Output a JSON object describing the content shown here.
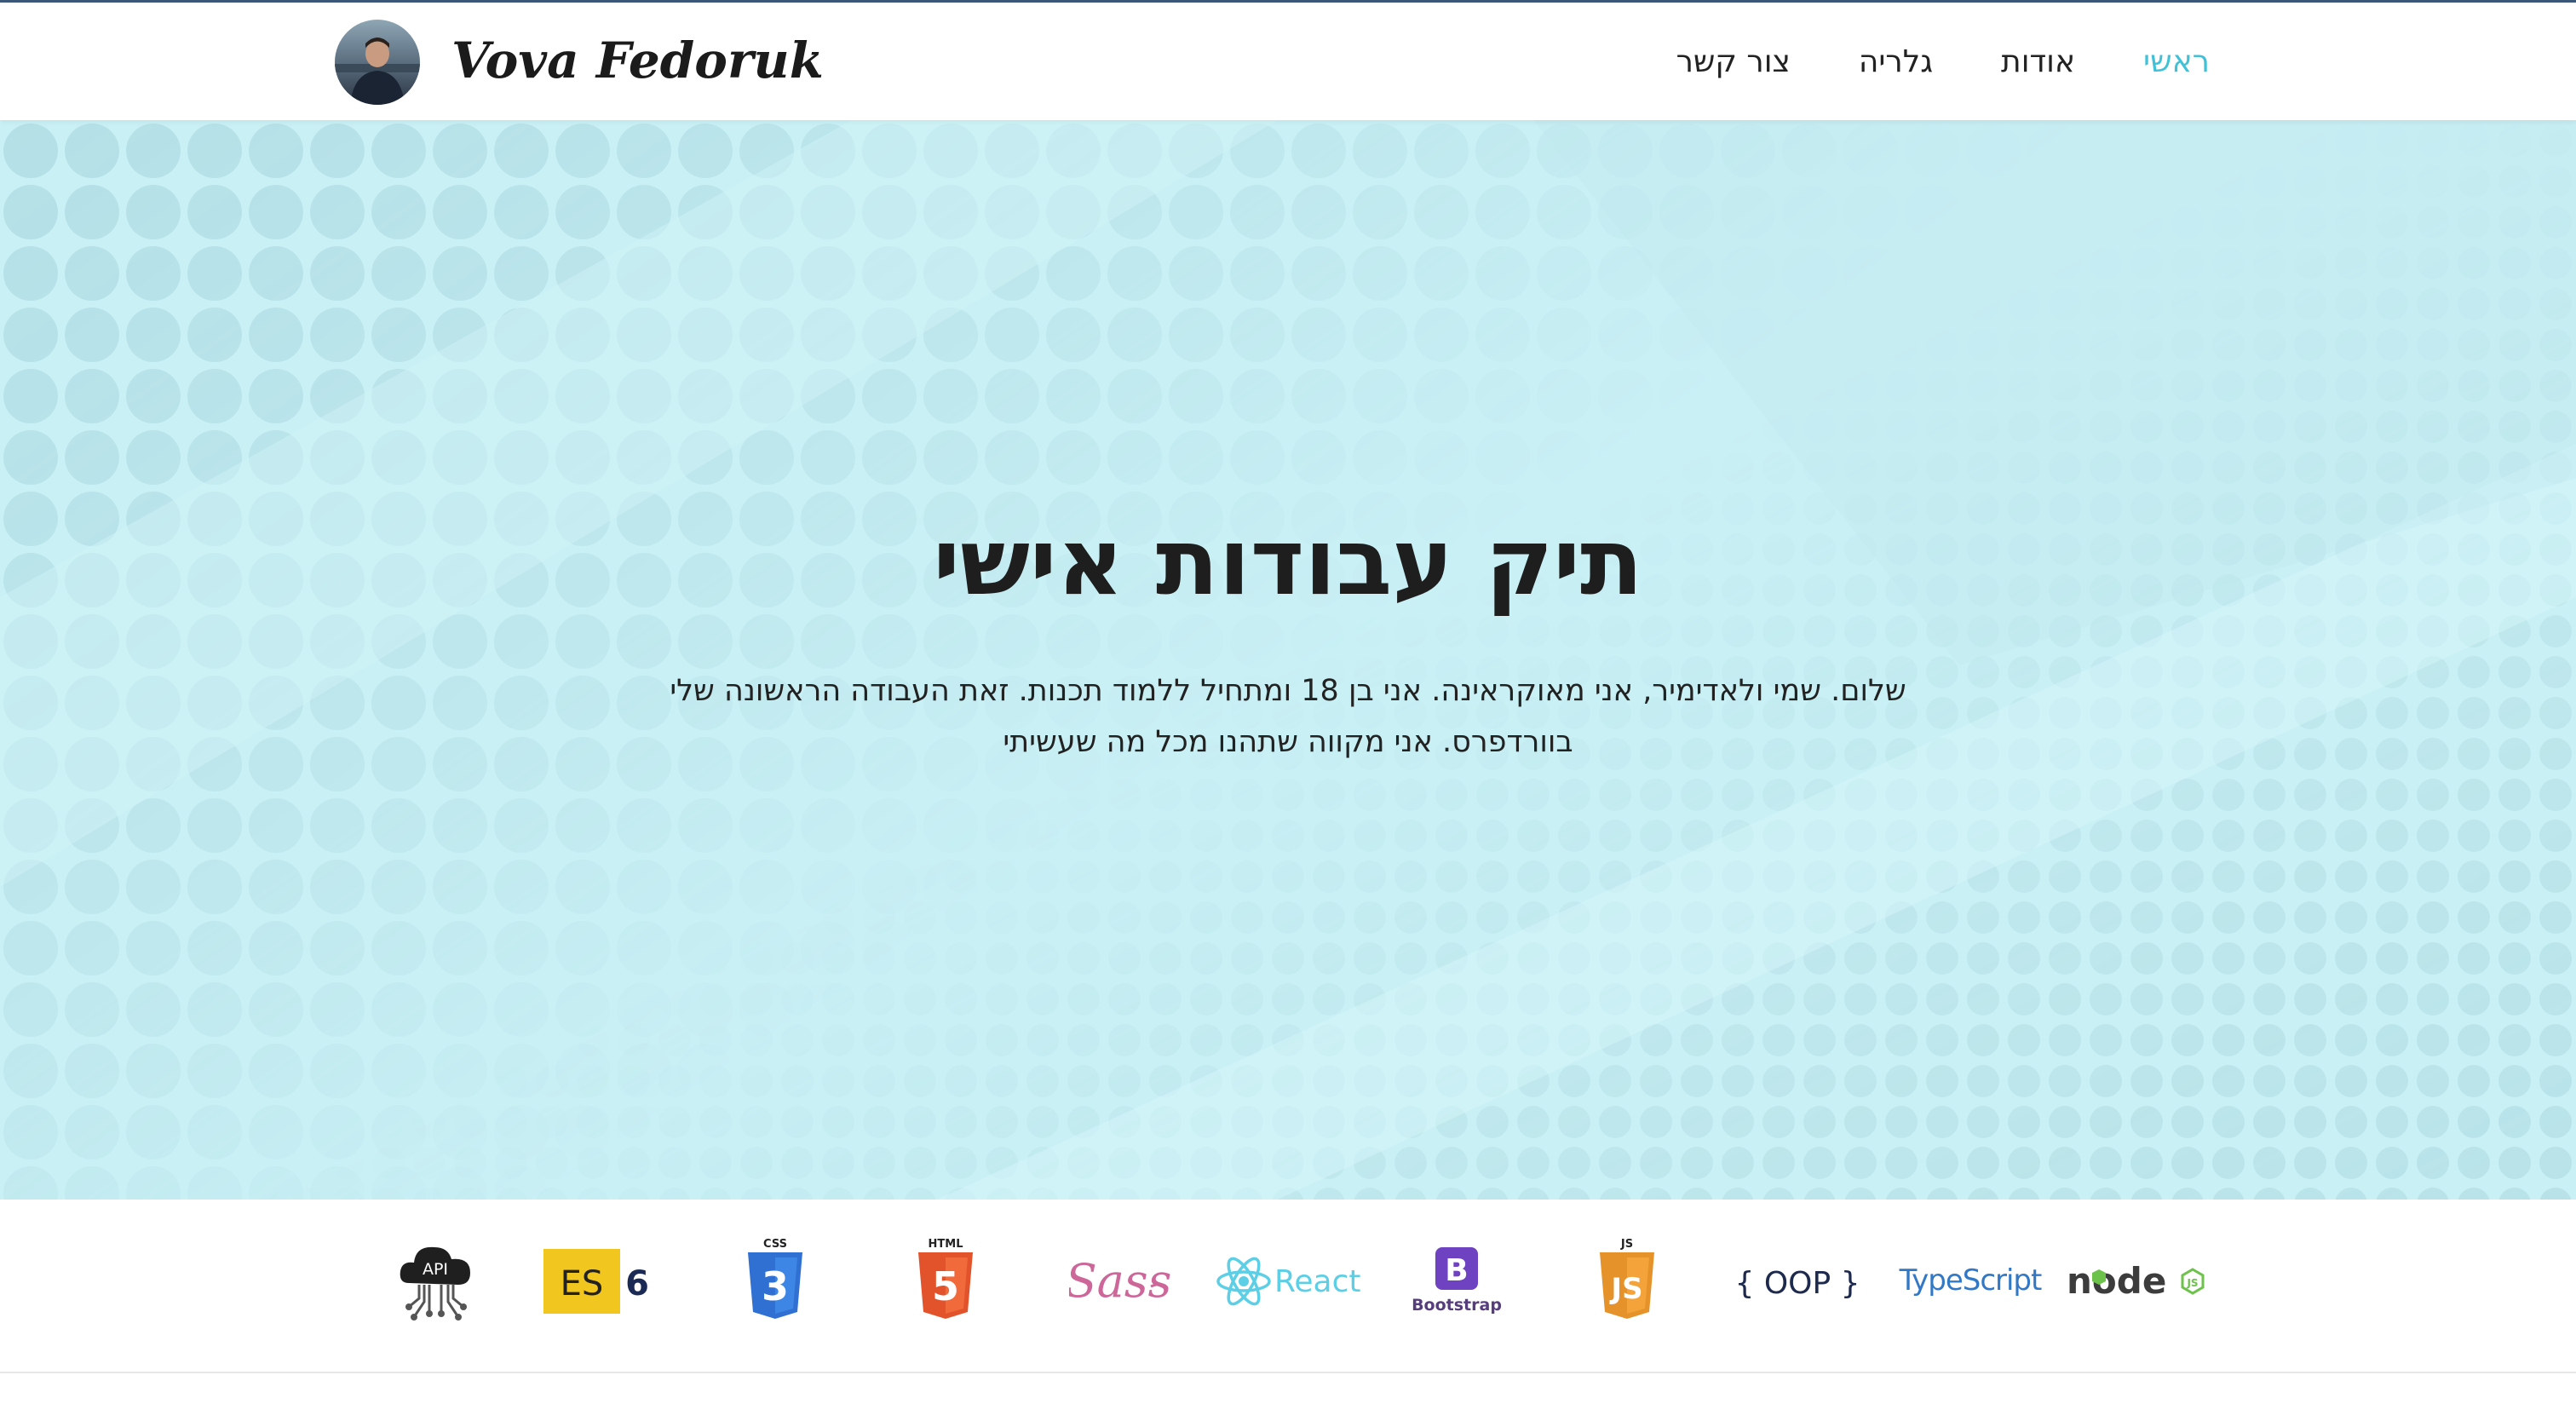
{
  "header": {
    "brand": "Vova Fedoruk",
    "nav": [
      {
        "label": "ראשי",
        "active": true
      },
      {
        "label": "אודות",
        "active": false
      },
      {
        "label": "גלריה",
        "active": false
      },
      {
        "label": "צור קשר",
        "active": false
      }
    ]
  },
  "hero": {
    "title": "תיק עבודות אישי",
    "text_line1": "שלום. שמי ולאדימיר, אני מאוקראינה. אני בן 18 ומתחיל ללמוד תכנות. זאת העבודה הראשונה שלי",
    "text_line2": "בוורדפרס. אני מקווה שתהנו מכל מה שעשיתי"
  },
  "tech_logos": {
    "api": "API",
    "es": "ES",
    "es_version": "6",
    "css_tag": "CSS",
    "css_number": "3",
    "html_tag": "HTML",
    "html_number": "5",
    "sass": "Sass",
    "react": "React",
    "bootstrap_letter": "B",
    "bootstrap": "Bootstrap",
    "js_tag": "JS",
    "js_letter": "JS",
    "oop": "{ OOP }",
    "typescript": "TypeScript",
    "node": "node"
  },
  "colors": {
    "accent": "#3fc2d8",
    "hero_bg": "#c9f0f5",
    "text": "#1e1e1e"
  }
}
